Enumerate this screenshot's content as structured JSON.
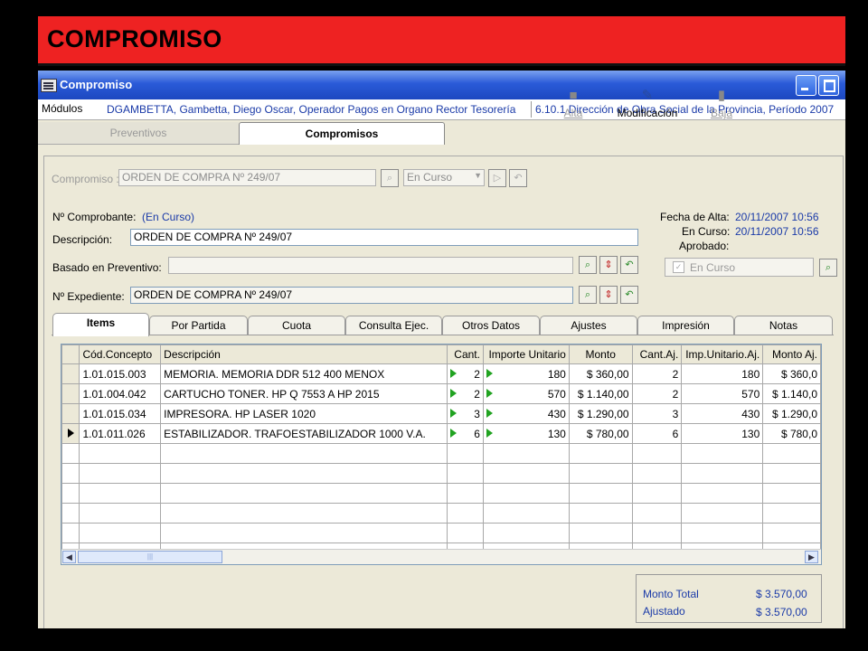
{
  "banner": {
    "title": "COMPROMISO"
  },
  "window": {
    "title": "Compromiso"
  },
  "modules": {
    "label": "Módulos",
    "user": "DGAMBETTA, Gambetta, Diego Oscar, Operador Pagos en Organo Rector Tesorería",
    "org": "6.10.1 Dirección de Obra Social de la Provincia, Período 2007"
  },
  "top_tabs": [
    "Preventivos",
    "Compromisos"
  ],
  "header": {
    "compromiso_label": "Compromiso :",
    "compromiso_value": "ORDEN DE COMPRA Nº 249/07",
    "estado_value": "En Curso"
  },
  "toolbar": {
    "alta": "Alta",
    "modificacion": "Modificación",
    "baja": "Baja"
  },
  "form": {
    "comprobante_label": "Nº Comprobante:",
    "comprobante_value": "(En Curso)",
    "descripcion_label": "Descripción:",
    "descripcion_value": "ORDEN DE COMPRA Nº 249/07",
    "preventivo_label": "Basado en Preventivo:",
    "preventivo_value": "",
    "expediente_label": "Nº Expediente:",
    "expediente_value": "ORDEN DE COMPRA Nº 249/07",
    "fecha_alta_label": "Fecha de Alta:",
    "fecha_alta_value": "20/11/2007 10:56",
    "en_curso_label": "En Curso:",
    "en_curso_value": "20/11/2007 10:56",
    "aprobado_label": "Aprobado:",
    "aprobado_check_label": "En Curso"
  },
  "detail_tabs": [
    "Items",
    "Por Partida",
    "Cuota",
    "Consulta Ejec.",
    "Otros Datos",
    "Ajustes",
    "Impresión",
    "Notas"
  ],
  "grid": {
    "columns": [
      "Cód.Concepto",
      "Descripción",
      "Cant.",
      "Importe Unitario",
      "Monto",
      "Cant.Aj.",
      "Imp.Unitario.Aj.",
      "Monto Aj."
    ],
    "rows": [
      [
        "1.01.015.003",
        "MEMORIA. MEMORIA DDR 512 400 MENOX",
        "2",
        "180",
        "$ 360,00",
        "2",
        "180",
        "$ 360,0"
      ],
      [
        "1.01.004.042",
        "CARTUCHO TONER. HP Q 7553 A HP 2015",
        "2",
        "570",
        "$ 1.140,00",
        "2",
        "570",
        "$ 1.140,0"
      ],
      [
        "1.01.015.034",
        "IMPRESORA. HP LASER 1020",
        "3",
        "430",
        "$ 1.290,00",
        "3",
        "430",
        "$ 1.290,0"
      ],
      [
        "1.01.011.026",
        "ESTABILIZADOR. TRAFOESTABILIZADOR 1000 V.A.",
        "6",
        "130",
        "$ 780,00",
        "6",
        "130",
        "$ 780,0"
      ]
    ],
    "current_row": 3
  },
  "totals": {
    "monto_total_label": "Monto Total",
    "monto_total_value": "$ 3.570,00",
    "ajustado_label": "Ajustado",
    "ajustado_value": "$ 3.570,00"
  },
  "colors": {
    "banner": "#ee2222",
    "titlebar": "#2a5ad8",
    "link_blue": "#1a3aa8",
    "play_green": "#21a321"
  },
  "icons": [
    "window-app-icon",
    "minimize-icon",
    "maximize-icon",
    "search-icon",
    "dropdown-icon",
    "next-icon",
    "undo-icon",
    "new-document-icon",
    "edit-document-icon",
    "trash-icon",
    "up-down-icon",
    "play-icon",
    "row-pointer-icon",
    "scroll-left-icon",
    "scroll-right-icon"
  ]
}
